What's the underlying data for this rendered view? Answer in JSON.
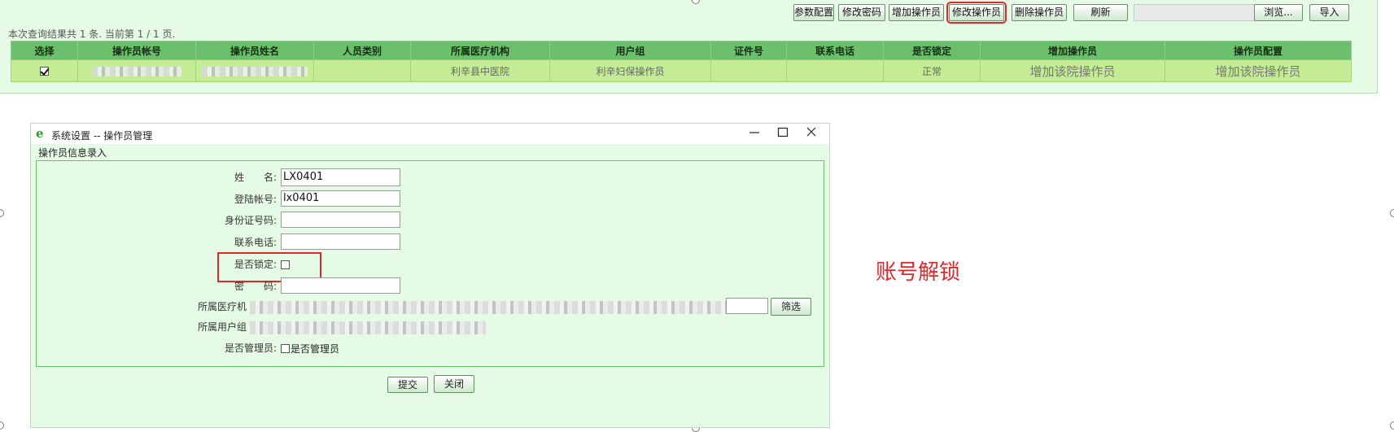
{
  "toolbar": {
    "buttons": [
      "参数配置",
      "修改密码",
      "增加操作员",
      "修改操作员",
      "删除操作员",
      "刷新"
    ],
    "browse_label": "浏览...",
    "import_label": "导入"
  },
  "summary": "本次查询结果共 1 条. 当前第 1 / 1 页.",
  "table": {
    "headers": [
      "选择",
      "操作员帐号",
      "操作员姓名",
      "人员类别",
      "所属医疗机构",
      "用户组",
      "证件号",
      "联系电话",
      "是否锁定",
      "增加操作员",
      "操作员配置"
    ],
    "rows": [
      {
        "selected": true,
        "org": "利辛县中医院",
        "group": "利辛妇保操作员",
        "locked": "正常",
        "add_op": "增加该院操作员",
        "config": "增加该院操作员"
      }
    ]
  },
  "dialog": {
    "title": "系统设置 -- 操作员管理",
    "legend": "操作员信息录入",
    "fields": {
      "name_label": "姓　　名:",
      "name_value": "LX0401",
      "login_label": "登陆帐号:",
      "login_value": "lx0401",
      "idcard_label": "身份证号码:",
      "phone_label": "联系电话:",
      "lock_label": "是否锁定:",
      "password_label": "密　　码:",
      "org_label": "所属医疗机",
      "group_label": "所属用户组",
      "admin_label": "是否管理员:",
      "admin_text": "是否管理员"
    },
    "filter_label": "筛选",
    "submit_label": "提交",
    "close_label": "关闭"
  },
  "annotation": "账号解锁",
  "colors": {
    "panel_bg": "#e6fbe6",
    "header_green": "#6cbf6c",
    "row_green": "#c4ec94",
    "highlight_red": "#e0282c"
  }
}
